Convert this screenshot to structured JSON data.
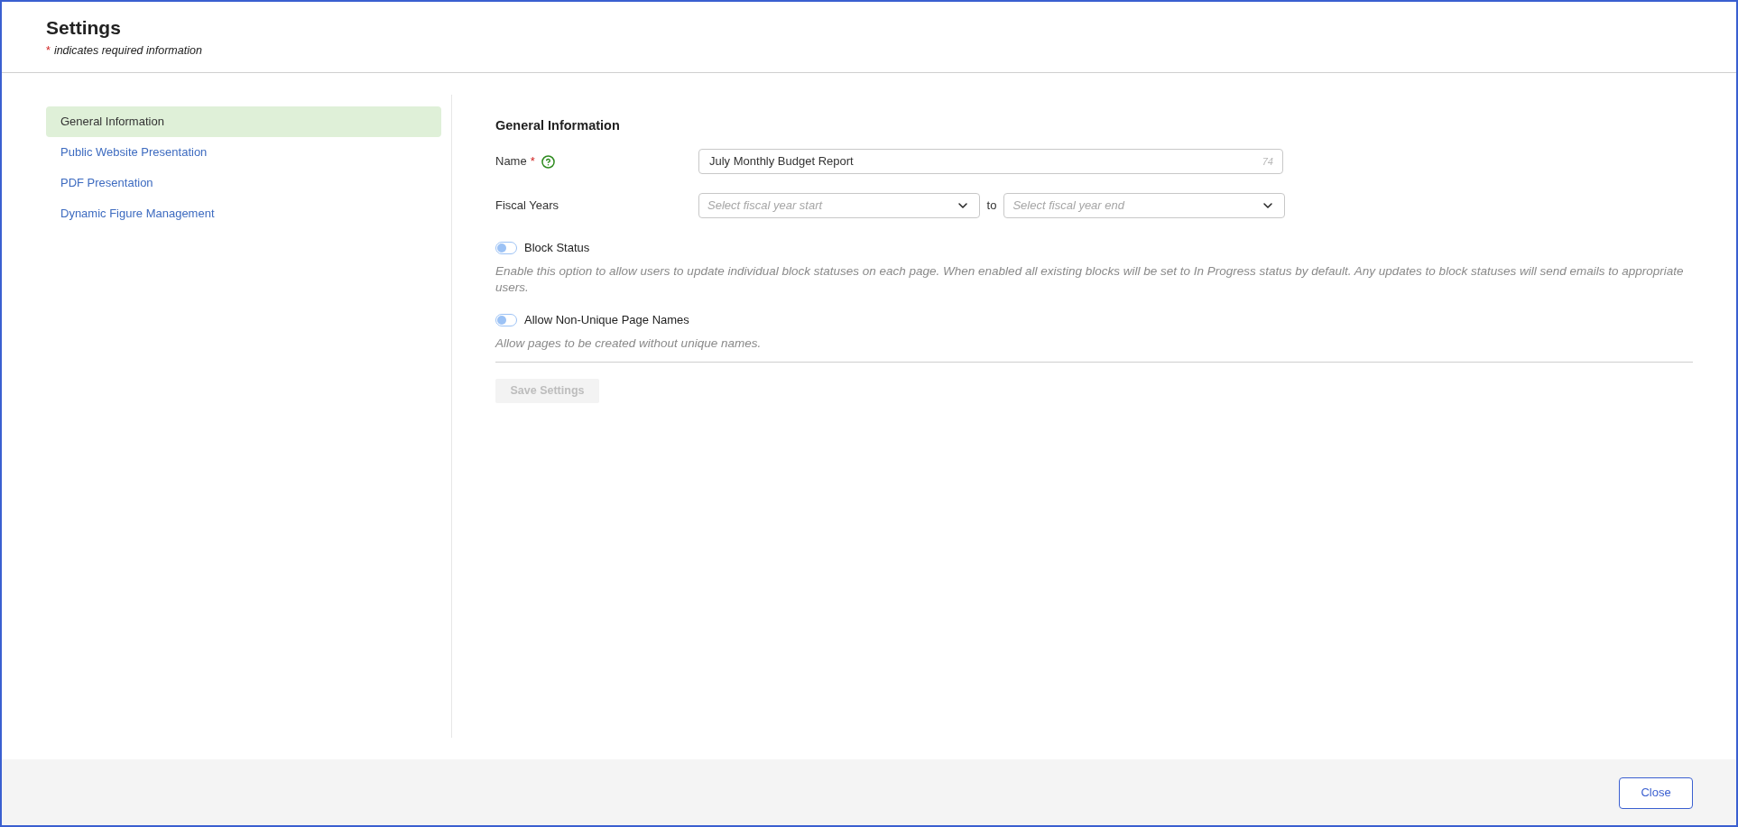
{
  "header": {
    "title": "Settings",
    "required_mark": "*",
    "note": "indicates required information"
  },
  "sidebar": {
    "items": [
      {
        "label": "General Information",
        "selected": true
      },
      {
        "label": "Public Website Presentation",
        "selected": false
      },
      {
        "label": "PDF Presentation",
        "selected": false
      },
      {
        "label": "Dynamic Figure Management",
        "selected": false
      }
    ]
  },
  "section": {
    "title": "General Information",
    "name_field": {
      "label": "Name",
      "required_mark": "*",
      "value": "July Monthly Budget Report",
      "counter": "74"
    },
    "fiscal_years": {
      "label": "Fiscal Years",
      "start": {
        "placeholder": "Select fiscal year start"
      },
      "separator": "to",
      "end": {
        "placeholder": "Select fiscal year end"
      }
    },
    "toggles": [
      {
        "label": "Block Status",
        "on": false,
        "description": "Enable this option to allow users to update individual block statuses on each page. When enabled all existing blocks will be set to In Progress status by default. Any updates to block statuses will send emails to appropriate users."
      },
      {
        "label": "Allow Non-Unique Page Names",
        "on": false,
        "description": "Allow pages to be created without unique names."
      }
    ],
    "save_button": {
      "label": "Save Settings",
      "disabled": true
    }
  },
  "footer": {
    "close_button": "Close"
  }
}
